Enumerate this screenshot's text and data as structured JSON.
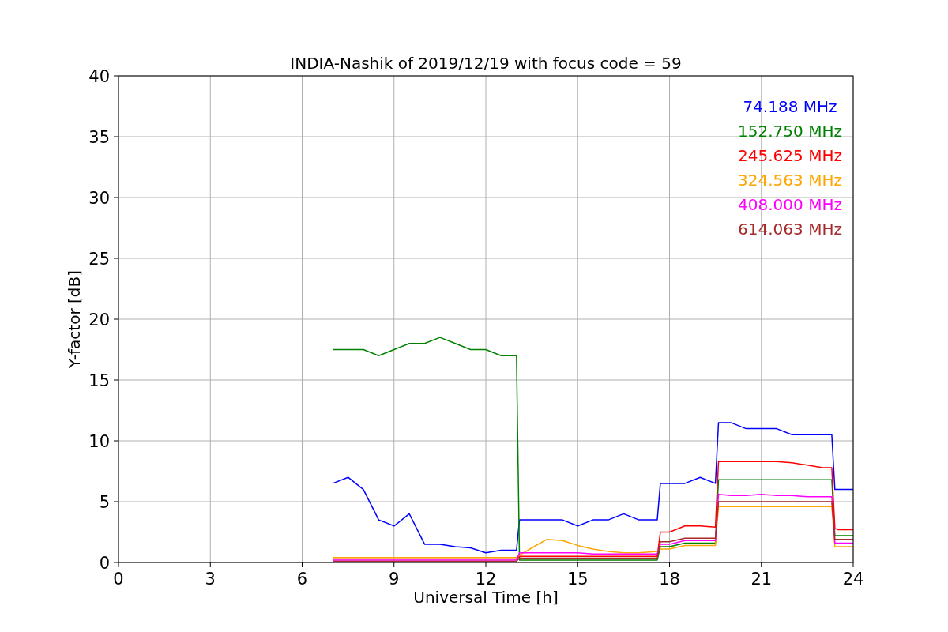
{
  "figure": {
    "chart_data": {
      "type": "line",
      "title": "INDIA-Nashik of 2019/12/19 with focus code = 59",
      "xlabel": "Universal Time [h]",
      "ylabel": "Y-factor [dB]",
      "grid": true,
      "x": [
        7,
        7.5,
        8,
        8.5,
        9,
        9.5,
        10,
        10.5,
        11,
        11.5,
        12,
        12.5,
        13,
        13.1,
        13.5,
        14,
        14.5,
        15,
        15.5,
        16,
        16.5,
        17,
        17.6,
        17.7,
        18,
        18.5,
        19,
        19.5,
        19.6,
        20,
        20.5,
        21,
        21.5,
        22,
        22.5,
        23,
        23.3,
        23.4,
        23.5,
        24
      ],
      "xlim": [
        0,
        24
      ],
      "ylim": [
        0,
        40
      ],
      "xticks": [
        0,
        3,
        6,
        9,
        12,
        15,
        18,
        21,
        24
      ],
      "yticks": [
        0,
        5,
        10,
        15,
        20,
        25,
        30,
        35,
        40
      ],
      "series": [
        {
          "name": "74.188 MHz",
          "color": "#0000ff",
          "values": [
            6.5,
            7,
            6,
            3.5,
            3,
            4,
            1.5,
            1.5,
            1.3,
            1.2,
            0.8,
            1,
            1,
            3.5,
            3.5,
            3.5,
            3.5,
            3,
            3.5,
            3.5,
            4,
            3.5,
            3.5,
            6.5,
            6.5,
            6.5,
            7,
            6.5,
            11.5,
            11.5,
            11,
            11,
            11,
            10.5,
            10.5,
            10.5,
            10.5,
            6,
            6,
            6
          ]
        },
        {
          "name": "152.750 MHz",
          "color": "#008000",
          "values": [
            17.5,
            17.5,
            17.5,
            17,
            17.5,
            18,
            18,
            18.5,
            18,
            17.5,
            17.5,
            17,
            17,
            0.2,
            0.2,
            0.2,
            0.2,
            0.2,
            0.2,
            0.2,
            0.2,
            0.2,
            0.2,
            1.3,
            1.3,
            1.6,
            1.6,
            1.6,
            6.8,
            6.8,
            6.8,
            6.8,
            6.8,
            6.8,
            6.8,
            6.8,
            6.8,
            2.2,
            2.2,
            2.2
          ]
        },
        {
          "name": "245.625 MHz",
          "color": "#ff0000",
          "values": [
            0.3,
            0.3,
            0.3,
            0.3,
            0.3,
            0.3,
            0.3,
            0.3,
            0.3,
            0.3,
            0.3,
            0.3,
            0.3,
            0.5,
            0.5,
            0.5,
            0.5,
            0.5,
            0.5,
            0.5,
            0.5,
            0.5,
            0.5,
            2.5,
            2.5,
            3,
            3,
            2.9,
            8.3,
            8.3,
            8.3,
            8.3,
            8.3,
            8.2,
            8,
            7.8,
            7.8,
            2.8,
            2.7,
            2.7
          ]
        },
        {
          "name": "324.563 MHz",
          "color": "#ffa500",
          "values": [
            0.4,
            0.4,
            0.4,
            0.4,
            0.4,
            0.4,
            0.4,
            0.4,
            0.4,
            0.4,
            0.4,
            0.4,
            0.4,
            0.6,
            1.2,
            1.9,
            1.8,
            1.4,
            1.1,
            0.9,
            0.8,
            0.8,
            0.9,
            1.1,
            1.1,
            1.4,
            1.4,
            1.4,
            4.6,
            4.6,
            4.6,
            4.6,
            4.6,
            4.6,
            4.6,
            4.6,
            4.6,
            1.3,
            1.3,
            1.3
          ]
        },
        {
          "name": "408.000 MHz",
          "color": "#ff00ff",
          "values": [
            0.2,
            0.2,
            0.2,
            0.2,
            0.2,
            0.2,
            0.2,
            0.2,
            0.2,
            0.2,
            0.2,
            0.2,
            0.2,
            0.8,
            0.8,
            0.8,
            0.8,
            0.8,
            0.7,
            0.7,
            0.7,
            0.7,
            0.7,
            1.5,
            1.5,
            1.8,
            1.8,
            1.8,
            5.6,
            5.5,
            5.5,
            5.6,
            5.5,
            5.5,
            5.4,
            5.4,
            5.4,
            1.6,
            1.6,
            1.6
          ]
        },
        {
          "name": "614.063 MHz",
          "color": "#a52a2a",
          "values": [
            0.1,
            0.1,
            0.1,
            0.1,
            0.1,
            0.1,
            0.1,
            0.1,
            0.1,
            0.1,
            0.1,
            0.1,
            0.1,
            0.35,
            0.35,
            0.35,
            0.35,
            0.35,
            0.35,
            0.35,
            0.35,
            0.35,
            0.35,
            1.7,
            1.7,
            2,
            2,
            2,
            5,
            5,
            5,
            5,
            5,
            5,
            5,
            5,
            5,
            1.9,
            1.9,
            1.9
          ]
        }
      ]
    }
  }
}
